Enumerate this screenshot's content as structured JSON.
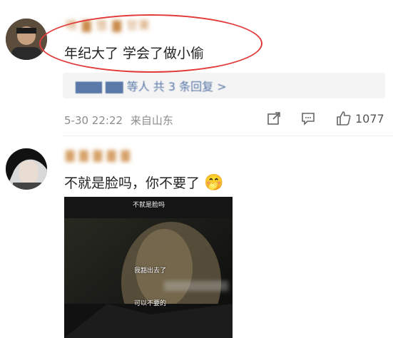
{
  "comment1": {
    "username": "啧 ▇ 悠 ▇ 甘果",
    "text": "年纪大了 学会了做小偷",
    "reply_bar": "▇▇▇ ▇▇ 等人  共 3 条回复 >",
    "date": "5-30 22:22",
    "location": "来自山东",
    "like_count": "1077"
  },
  "comment2": {
    "username": "▇ ▇ ▇ ▇ ▇",
    "text": "不就是脸吗，你不要了",
    "emoji": "🤭",
    "video_subtitles": [
      "不就是脸吗",
      "我豁出去了",
      "可以不要的"
    ]
  },
  "colors": {
    "annotation": "#e23a3a",
    "username": "#c98a4a",
    "reply_link": "#5a78a8"
  }
}
